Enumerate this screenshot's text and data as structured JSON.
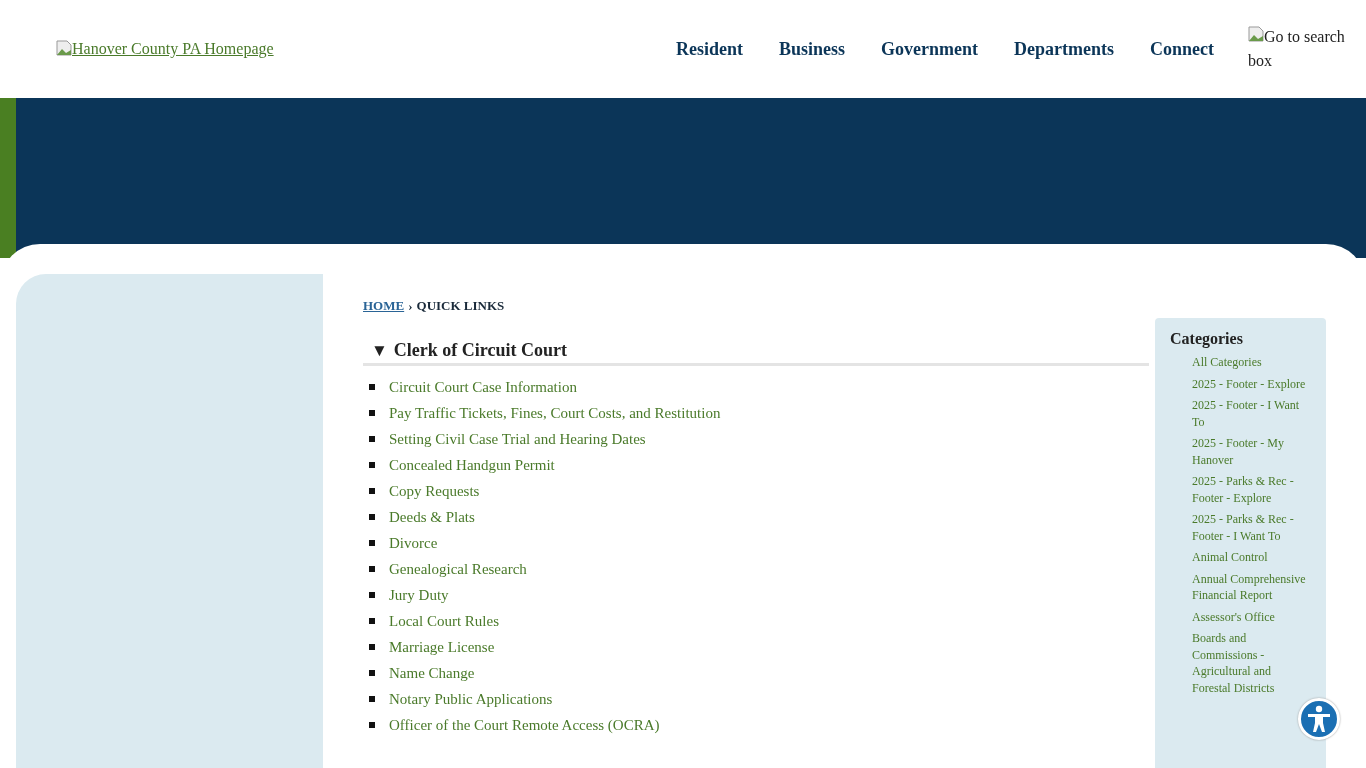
{
  "header": {
    "logo_alt": "Hanover County PA Homepage",
    "nav": [
      "Resident",
      "Business",
      "Government",
      "Departments",
      "Connect"
    ],
    "search_alt": "Go to search box"
  },
  "breadcrumb": {
    "home": "HOME",
    "separator": "›",
    "current": "QUICK LINKS"
  },
  "section": {
    "toggle": "▼",
    "title": "Clerk of Circuit Court",
    "expanded": true,
    "links": [
      "Circuit Court Case Information",
      "Pay Traffic Tickets, Fines, Court Costs, and Restitution",
      "Setting Civil Case Trial and Hearing Dates",
      "Concealed Handgun Permit",
      "Copy Requests",
      "Deeds & Plats",
      "Divorce",
      "Genealogical Research",
      "Jury Duty",
      "Local Court Rules",
      "Marriage License",
      "Name Change",
      "Notary Public Applications",
      "Officer of the Court Remote Access (OCRA)"
    ]
  },
  "categories": {
    "title": "Categories",
    "items": [
      "All Categories",
      "2025 - Footer - Explore",
      "2025 - Footer - I Want To",
      "2025 - Footer - My Hanover",
      "2025 - Parks & Rec - Footer - Explore",
      "2025 - Parks & Rec - Footer - I Want To",
      "Animal Control",
      "Annual Comprehensive Financial Report",
      "Assessor's Office",
      "Boards and Commissions - Agricultural and Forestal Districts"
    ]
  }
}
